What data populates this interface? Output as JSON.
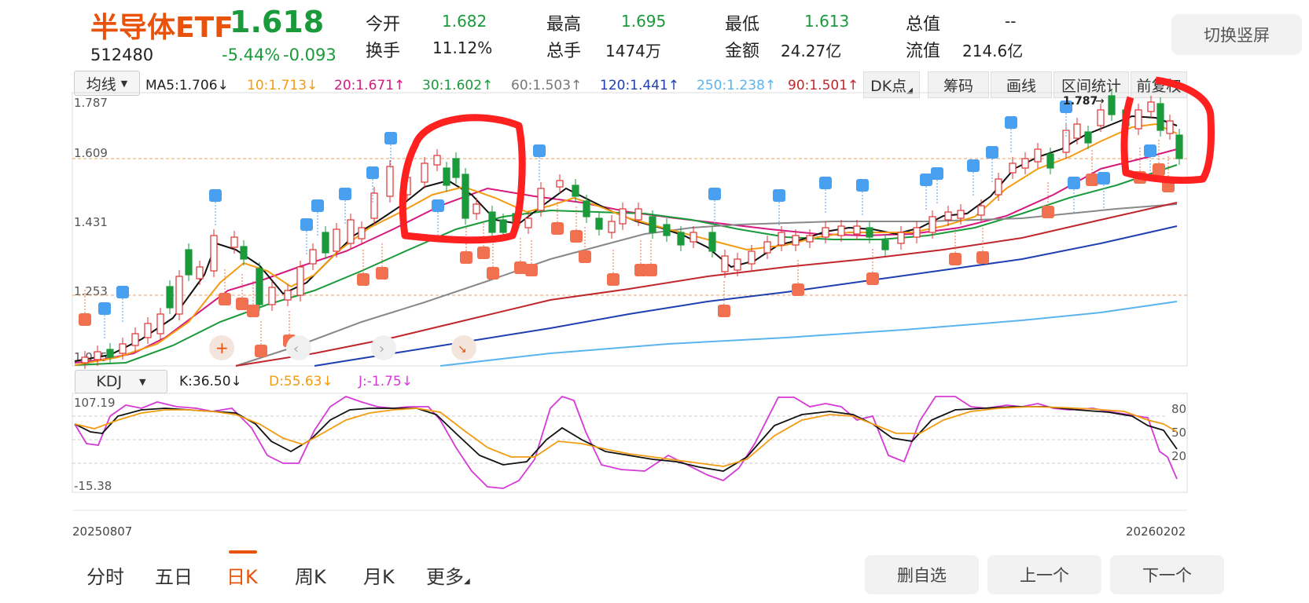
{
  "header": {
    "name": "半导体ETF",
    "price": "1.618",
    "code": "512480",
    "change_pct": "-5.44%",
    "change_amt": "-0.093",
    "stats": [
      {
        "label": "今开",
        "value": "1.682",
        "green": true
      },
      {
        "label": "换手",
        "value": "11.12%",
        "green": false
      },
      {
        "label": "最高",
        "value": "1.695",
        "green": true
      },
      {
        "label": "总手",
        "value": "1474万",
        "green": false
      },
      {
        "label": "最低",
        "value": "1.613",
        "green": true
      },
      {
        "label": "金额",
        "value": "24.27亿",
        "green": false
      },
      {
        "label": "总值",
        "value": "--",
        "green": false
      },
      {
        "label": "流值",
        "value": "214.6亿",
        "green": false
      }
    ],
    "switch_button": "切换竖屏"
  },
  "ma_bar": {
    "selector": "均线",
    "items": [
      {
        "text": "MA5:1.706↓",
        "color": "#111111"
      },
      {
        "text": "10:1.713↓",
        "color": "#f39c12"
      },
      {
        "text": "20:1.671↑",
        "color": "#d6197e"
      },
      {
        "text": "30:1.602↑",
        "color": "#1a9a3a"
      },
      {
        "text": "60:1.503↑",
        "color": "#777777"
      },
      {
        "text": "120:1.441↑",
        "color": "#1f3fb0"
      },
      {
        "text": "250:1.238↑",
        "color": "#5ab4ee"
      },
      {
        "text": "90:1.501↑",
        "color": "#c0272d"
      }
    ],
    "tools": [
      "DK点",
      "筹码",
      "画线",
      "区间统计",
      "前复权"
    ]
  },
  "price_axis": [
    "1.787",
    "1.609",
    "1.431",
    "1.253",
    "1.075"
  ],
  "price_hi_label": "1.787",
  "kdj": {
    "selector": "KDJ",
    "k": "K:36.50↓",
    "d": "D:55.63↓",
    "j": "J:-1.75↓",
    "axis_left": [
      "107.19",
      "-15.38"
    ],
    "axis_right": [
      "80",
      "50",
      "20"
    ]
  },
  "dates": {
    "start": "20250807",
    "end": "20260202"
  },
  "tabs": [
    "分时",
    "五日",
    "日K",
    "周K",
    "月K",
    "更多"
  ],
  "active_tab": "日K",
  "bottom_buttons": [
    "删自选",
    "上一个",
    "下一个"
  ],
  "colors": {
    "up": "#e03030",
    "down": "#1a9a3a",
    "accent": "#e8520a",
    "annotation": "#ff2020"
  }
}
